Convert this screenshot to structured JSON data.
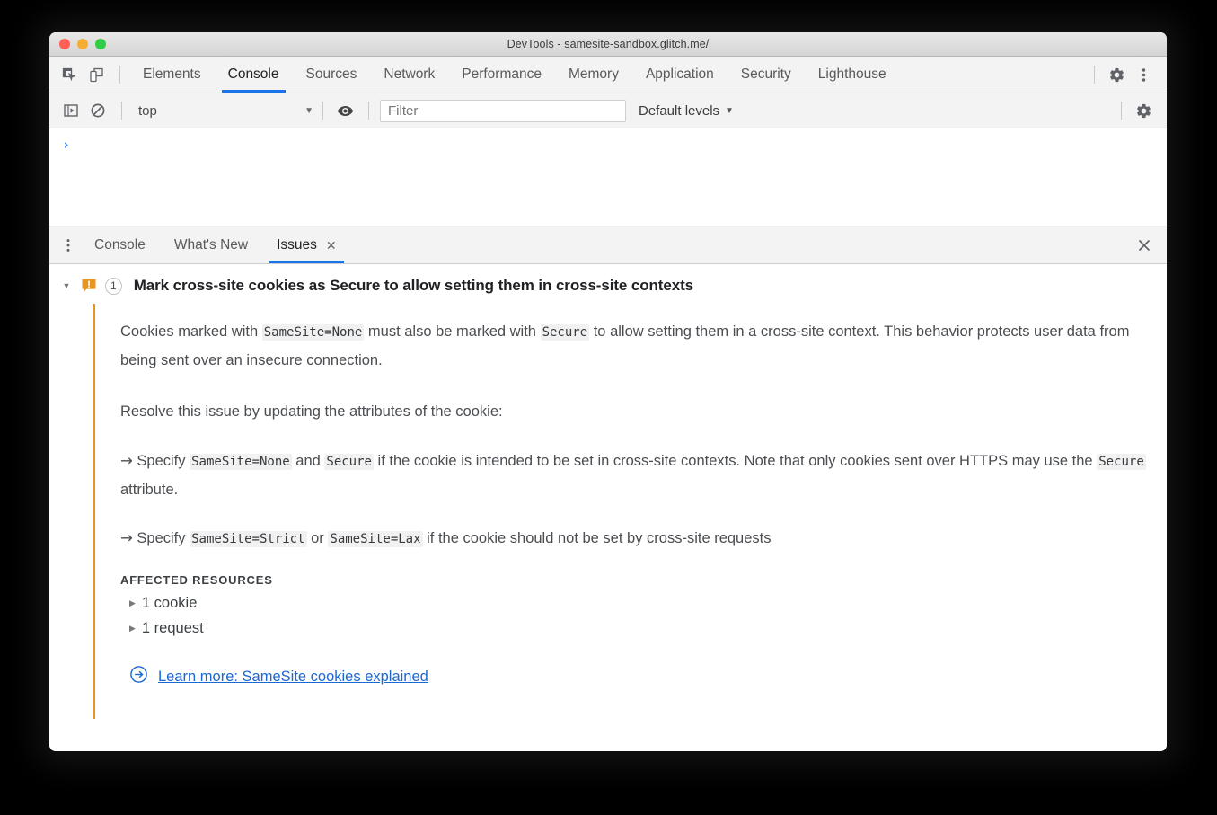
{
  "window": {
    "title": "DevTools - samesite-sandbox.glitch.me/",
    "traffic_lights": [
      "close-red",
      "minimize-yellow",
      "zoom-green"
    ]
  },
  "main_toolbar": {
    "icons": [
      {
        "name": "inspect-element-icon",
        "label": "Inspect"
      },
      {
        "name": "device-toolbar-icon",
        "label": "Toggle device toolbar"
      }
    ],
    "tabs": [
      {
        "label": "Elements",
        "active": false
      },
      {
        "label": "Console",
        "active": true
      },
      {
        "label": "Sources",
        "active": false
      },
      {
        "label": "Network",
        "active": false
      },
      {
        "label": "Performance",
        "active": false
      },
      {
        "label": "Memory",
        "active": false
      },
      {
        "label": "Application",
        "active": false
      },
      {
        "label": "Security",
        "active": false
      },
      {
        "label": "Lighthouse",
        "active": false
      }
    ],
    "settings_label": "Settings",
    "more_label": "Customize and control DevTools"
  },
  "console_toolbar": {
    "sidebar_toggle_label": "Show console sidebar",
    "clear_console_label": "Clear console",
    "context_value": "top",
    "context_caret": "▼",
    "live_expression_label": "Create live expression",
    "filter_placeholder": "Filter",
    "filter_value": "",
    "levels_label": "Default levels",
    "levels_caret": "▼",
    "settings_label": "Console settings"
  },
  "console": {
    "prompt": "›"
  },
  "drawer": {
    "more_options_label": "More options",
    "tabs": [
      {
        "label": "Console",
        "active": false,
        "closable": false
      },
      {
        "label": "What's New",
        "active": false,
        "closable": false
      },
      {
        "label": "Issues",
        "active": true,
        "closable": true,
        "close_glyph": "✕"
      }
    ],
    "close_label": "✕"
  },
  "issue": {
    "disclosure_glyph": "▼",
    "severity": "warning",
    "severity_color": "#e8961f",
    "count": "1",
    "title": "Mark cross-site cookies as Secure to allow setting them in cross-site contexts",
    "paragraph_1": {
      "part_1": "Cookies marked with ",
      "code_1": "SameSite=None",
      "part_2": " must also be marked with ",
      "code_2": "Secure",
      "part_3": " to allow setting them in a cross-site context. This behavior protects user data from being sent over an insecure connection."
    },
    "paragraph_2": "Resolve this issue by updating the attributes of the cookie:",
    "bullets": [
      {
        "arrow": "→",
        "part_1": " Specify ",
        "code_1": "SameSite=None",
        "part_2": " and ",
        "code_2": "Secure",
        "part_3": " if the cookie is intended to be set in cross-site contexts. Note that only cookies sent over HTTPS may use the ",
        "code_3": "Secure",
        "part_4": " attribute."
      },
      {
        "arrow": "→",
        "part_1": " Specify ",
        "code_1": "SameSite=Strict",
        "part_2": " or ",
        "code_2": "SameSite=Lax",
        "part_3": " if the cookie should not be set by cross-site requests",
        "code_3": "",
        "part_4": ""
      }
    ],
    "affected_resources_label": "AFFECTED RESOURCES",
    "resources": [
      {
        "caret": "▶",
        "label": "1 cookie"
      },
      {
        "caret": "▶",
        "label": "1 request"
      }
    ],
    "learn_more": {
      "icon_name": "circle-arrow-right-icon",
      "text": "Learn more: SameSite cookies explained",
      "color": "#1a68d1"
    }
  }
}
